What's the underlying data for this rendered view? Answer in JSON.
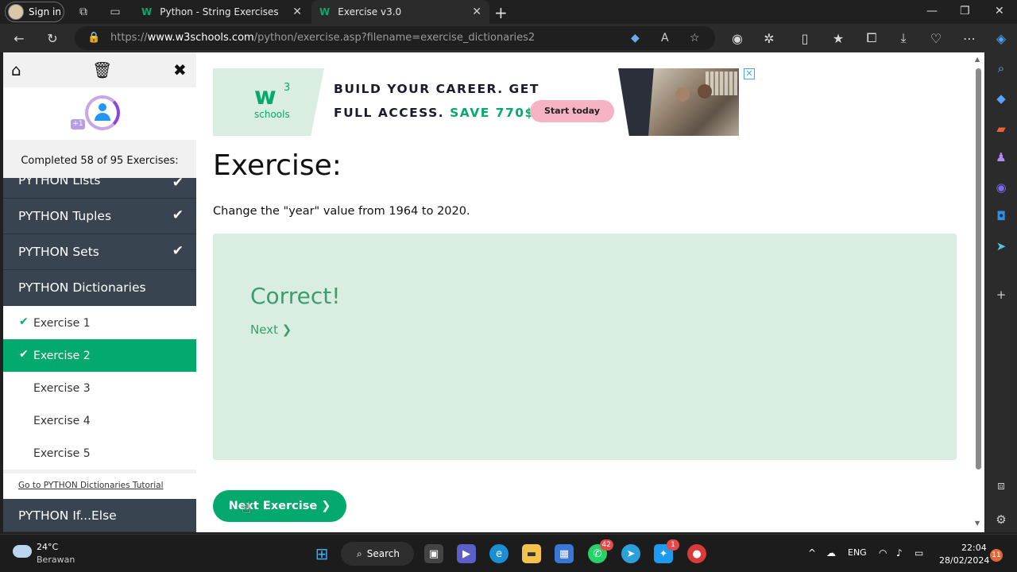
{
  "browser": {
    "signin_label": "Sign in",
    "tabs": [
      {
        "title": "Python - String Exercises",
        "icon": "w3schools-icon"
      },
      {
        "title": "Exercise v3.0",
        "icon": "w3schools-icon"
      }
    ],
    "url_prefix": "https://",
    "url_domain": "www.w3schools.com",
    "url_path": "/python/exercise.asp?filename=exercise_dictionaries2"
  },
  "sidebar": {
    "completed_text": "Completed 58 of 95 Exercises:",
    "plus_badge": "+1",
    "categories": [
      {
        "label": "PYTHON Lists",
        "done": true
      },
      {
        "label": "PYTHON Tuples",
        "done": true
      },
      {
        "label": "PYTHON Sets",
        "done": true
      },
      {
        "label": "PYTHON Dictionaries",
        "done": false
      }
    ],
    "exercises": [
      {
        "label": "Exercise 1",
        "done": true,
        "active": false
      },
      {
        "label": "Exercise 2",
        "done": true,
        "active": true
      },
      {
        "label": "Exercise 3",
        "done": false,
        "active": false
      },
      {
        "label": "Exercise 4",
        "done": false,
        "active": false
      },
      {
        "label": "Exercise 5",
        "done": false,
        "active": false
      }
    ],
    "tutorial_link": "Go to PYTHON Dictionaries Tutorial",
    "next_category": "PYTHON If...Else"
  },
  "ad": {
    "logo_w": "w",
    "logo_sup": "3",
    "logo_text": "schools",
    "line1": "BUILD YOUR CAREER. GET",
    "line2_a": "FULL ACCESS.",
    "line2_b": "SAVE 770$",
    "button": "Start today",
    "close": "✕"
  },
  "main": {
    "title": "Exercise:",
    "description": "Change the \"year\" value from 1964 to 2020.",
    "result_title": "Correct!",
    "next_link": "Next ❯",
    "next_button": "Next Exercise ❯"
  },
  "taskbar": {
    "temp": "24°C",
    "weather": "Berawan",
    "search": "Search",
    "whatsapp_badge": "42",
    "twitter_badge": "1",
    "lang": "ENG",
    "time": "22:04",
    "date": "28/02/2024",
    "notifications": "11"
  },
  "colors": {
    "accent": "#04aa6d",
    "sidebar_dark": "#384450",
    "result_bg": "#d9eee1"
  }
}
